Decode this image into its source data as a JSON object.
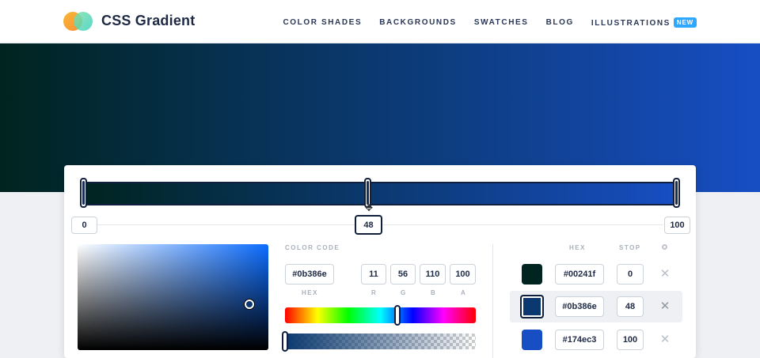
{
  "header": {
    "brand": "CSS Gradient",
    "nav": [
      {
        "label": "COLOR SHADES"
      },
      {
        "label": "BACKGROUNDS"
      },
      {
        "label": "SWATCHES"
      },
      {
        "label": "BLOG"
      },
      {
        "label": "ILLUSTRATIONS",
        "badge": "NEW"
      }
    ]
  },
  "gradient": {
    "stops": [
      {
        "hex": "#00241f",
        "stop": "0"
      },
      {
        "hex": "#0b386e",
        "stop": "48"
      },
      {
        "hex": "#174ec3",
        "stop": "100"
      }
    ],
    "active_stop": "48"
  },
  "picker": {
    "color_code_label": "COLOR CODE",
    "hex": "#0b386e",
    "r": "11",
    "g": "56",
    "b": "110",
    "a": "100",
    "hex_label": "HEX",
    "r_label": "R",
    "g_label": "G",
    "b_label": "B",
    "a_label": "A",
    "hue_position": 0.59,
    "alpha_position": 0.0
  },
  "stops_table": {
    "hex_header": "HEX",
    "stop_header": "STOP",
    "rows": [
      {
        "hex": "#00241f",
        "stop": "0",
        "color": "#00241f"
      },
      {
        "hex": "#0b386e",
        "stop": "48",
        "color": "#0b386e"
      },
      {
        "hex": "#174ec3",
        "stop": "100",
        "color": "#174ec3"
      }
    ],
    "remove_glyph": "✕"
  },
  "colors": {
    "accent": "#2ea8ff",
    "dark": "#0f1f3d"
  }
}
